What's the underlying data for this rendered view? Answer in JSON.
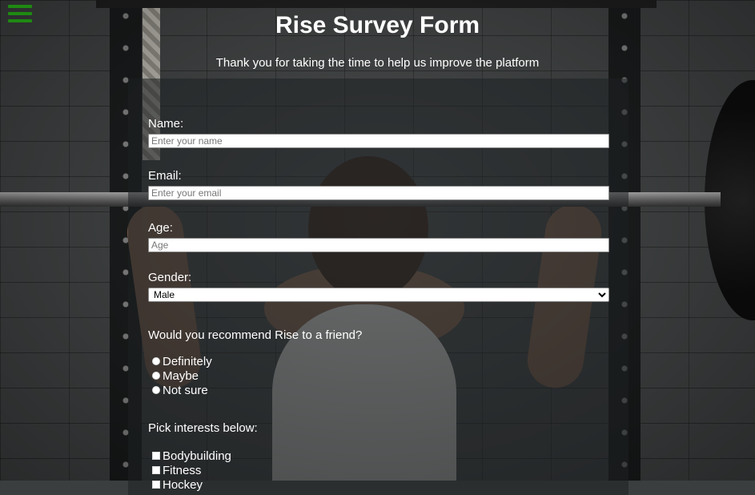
{
  "header": {
    "title": "Rise Survey Form",
    "subtitle": "Thank you for taking the time to help us improve the platform"
  },
  "menu": {
    "icon": "hamburger-menu-icon",
    "color": "#1e8a12"
  },
  "form": {
    "name": {
      "label": "Name:",
      "placeholder": "Enter your name",
      "value": ""
    },
    "email": {
      "label": "Email:",
      "placeholder": "Enter your email",
      "value": ""
    },
    "age": {
      "label": "Age:",
      "placeholder": "Age",
      "value": ""
    },
    "gender": {
      "label": "Gender:",
      "selected": "Male"
    },
    "recommend": {
      "question": "Would you recommend Rise to a friend?",
      "options": [
        "Definitely",
        "Maybe",
        "Not sure"
      ]
    },
    "interests": {
      "question": "Pick interests below:",
      "options": [
        "Bodybuilding",
        "Fitness",
        "Hockey"
      ]
    }
  }
}
